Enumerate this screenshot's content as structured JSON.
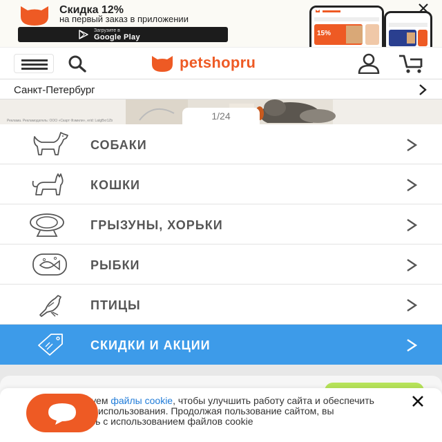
{
  "promo": {
    "title": "Скидка 12%",
    "subtitle": "на первый заказ в приложении",
    "store_small": "Загрузите в",
    "store_name": "Google Play",
    "screen_badge": "15%",
    "close_icon": "close-icon"
  },
  "header": {
    "menu_icon": "hamburger-icon",
    "search_icon": "search-icon",
    "logo_text": "petshopru",
    "user_icon": "user-icon",
    "cart_icon": "cart-icon"
  },
  "city": {
    "label": "Санкт-Петербург"
  },
  "slider": {
    "pager": "1/24",
    "legal": "Реклама. Рекламодатель: ООО «Скарт Фэмили», erid: LatgBxr1Zb"
  },
  "categories": [
    {
      "label": "СОБАКИ",
      "icon": "dog-icon"
    },
    {
      "label": "КОШКИ",
      "icon": "cat-icon"
    },
    {
      "label": "ГРЫЗУНЫ, ХОРЬКИ",
      "icon": "hamster-icon"
    },
    {
      "label": "РЫБКИ",
      "icon": "fish-icon"
    },
    {
      "label": "ПТИЦЫ",
      "icon": "bird-icon"
    },
    {
      "label": "СКИДКИ И АКЦИИ",
      "icon": "price-tag-icon",
      "active": true
    }
  ],
  "cookie": {
    "text_pre": "Мы используем ",
    "link": "файлы cookie",
    "text_post": ", чтобы улучшить работу сайта и обеспечить удобство его использования. Продолжая пользование сайтом, вы соглашаетесь с использованием файлов cookie"
  },
  "colors": {
    "brand_orange": "#ee5a24",
    "accent_blue": "#3d9be9",
    "link_blue": "#1f7bd8",
    "promo_green": "#b6e35a"
  }
}
